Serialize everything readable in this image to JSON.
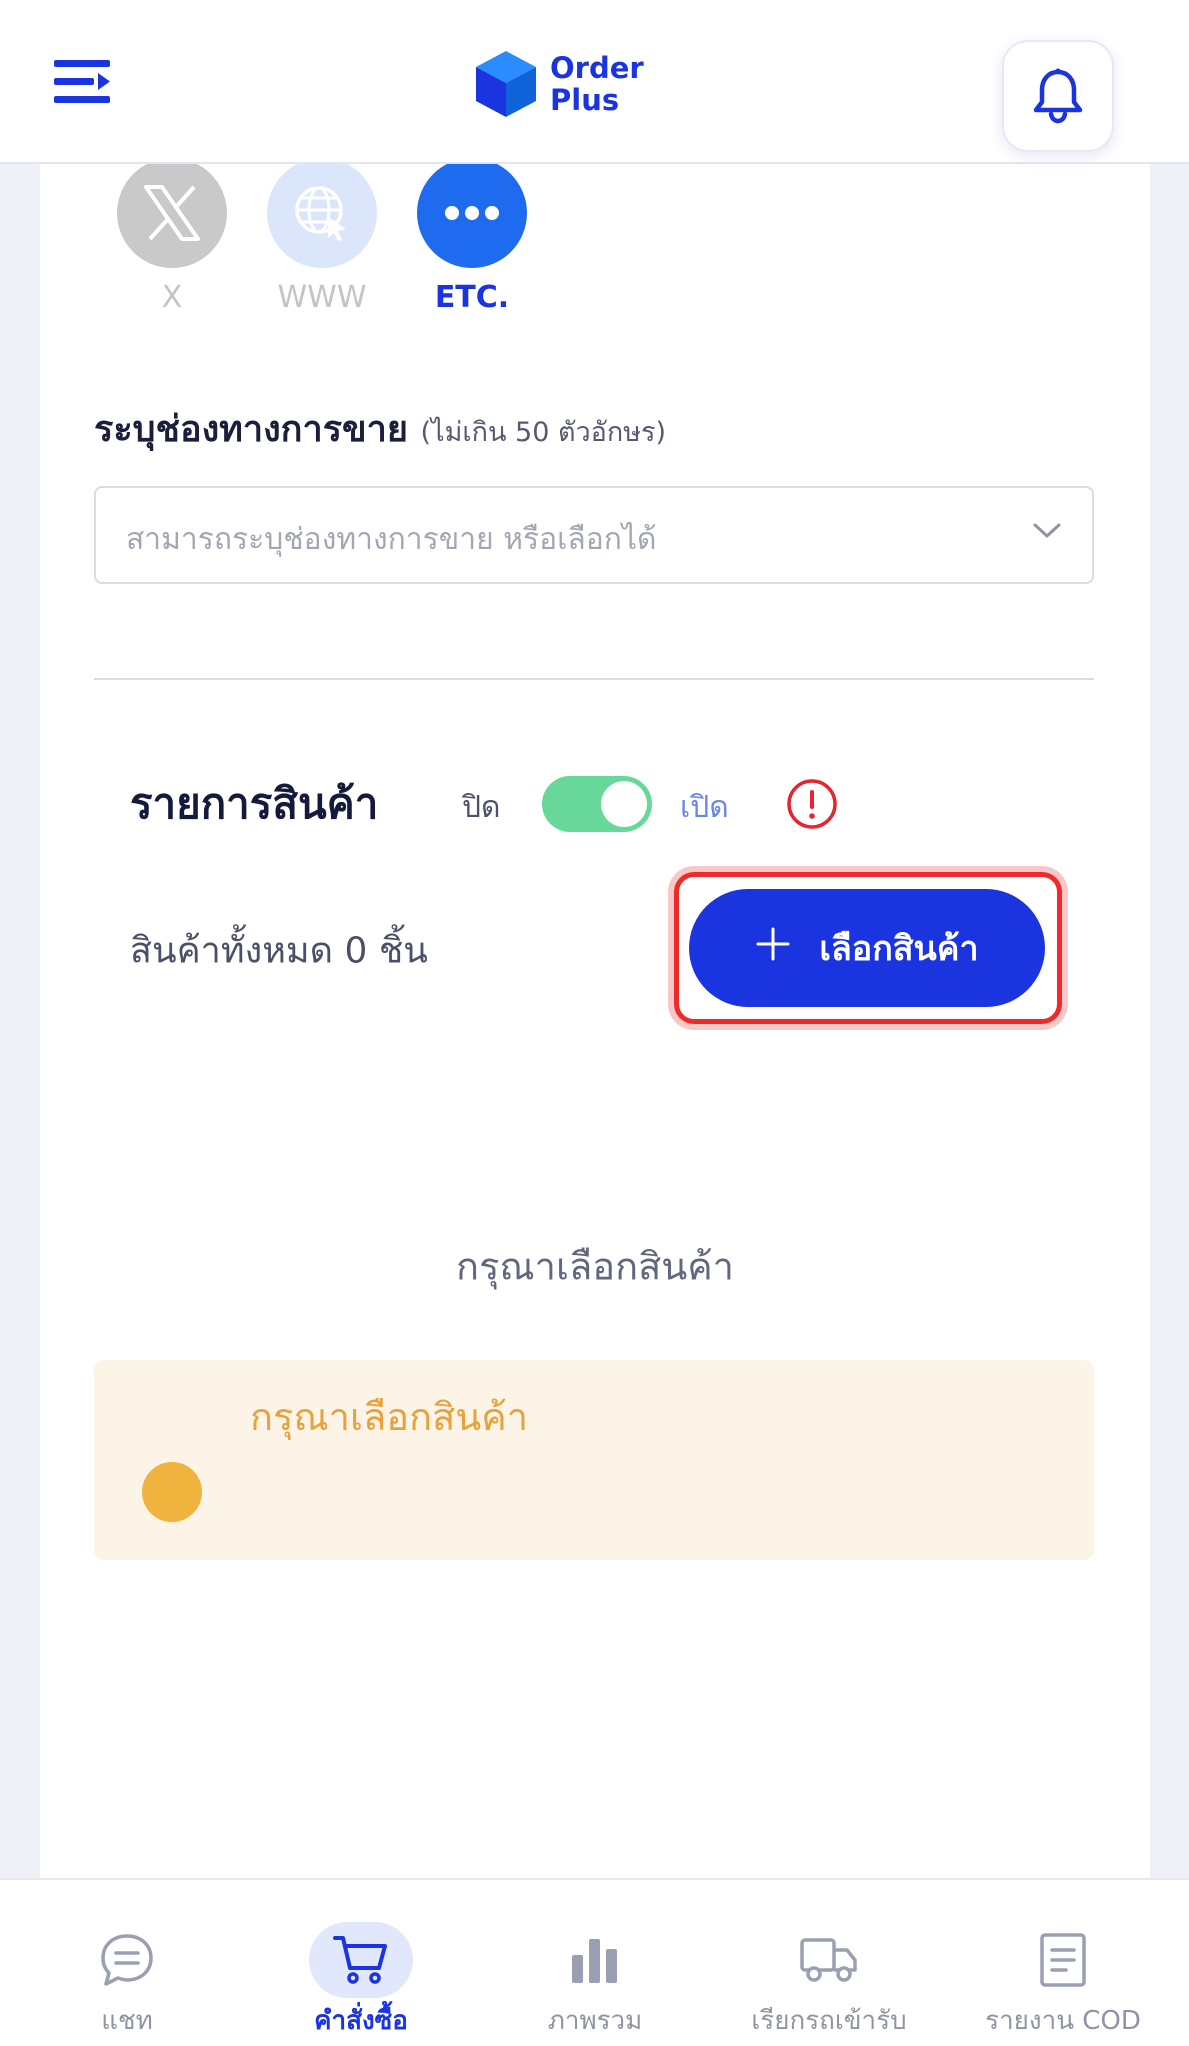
{
  "app": {
    "logo_line1": "Order",
    "logo_line2": "Plus"
  },
  "header": {
    "menu_icon": "menu-icon",
    "bell_icon": "bell-icon"
  },
  "channels": [
    {
      "label": "X",
      "icon": "x-logo-icon",
      "selected": false
    },
    {
      "label": "WWW",
      "icon": "globe-cursor-icon",
      "selected": false
    },
    {
      "label": "ETC.",
      "icon": "more-dots-icon",
      "selected": true
    }
  ],
  "sales_channel": {
    "label": "ระบุช่องทางการขาย",
    "hint": "(ไม่เกิน 50 ตัวอักษร)",
    "placeholder": "สามารถระบุช่องทางการขาย หรือเลือกได้"
  },
  "products": {
    "title": "รายการสินค้า",
    "toggle_off_label": "ปิด",
    "toggle_on_label": "เปิด",
    "toggle_state": "on",
    "total_text": "สินค้าทั้งหมด 0 ชิ้น",
    "select_button": "เลือกสินค้า",
    "empty_message": "กรุณาเลือกสินค้า",
    "warning_text": "กรุณาเลือกสินค้า"
  },
  "colors": {
    "primary": "#1a35e0",
    "toggle_on": "#67d89a",
    "warning": "#e8a23c",
    "highlight": "#ee2a2a"
  },
  "bottom_nav": [
    {
      "label": "แชท",
      "icon": "chat-icon",
      "active": false
    },
    {
      "label": "คำสั่งซื้อ",
      "icon": "cart-icon",
      "active": true
    },
    {
      "label": "ภาพรวม",
      "icon": "bar-chart-icon",
      "active": false
    },
    {
      "label": "เรียกรถเข้ารับ",
      "icon": "truck-icon",
      "active": false
    },
    {
      "label": "รายงาน COD",
      "icon": "report-icon",
      "active": false
    }
  ]
}
